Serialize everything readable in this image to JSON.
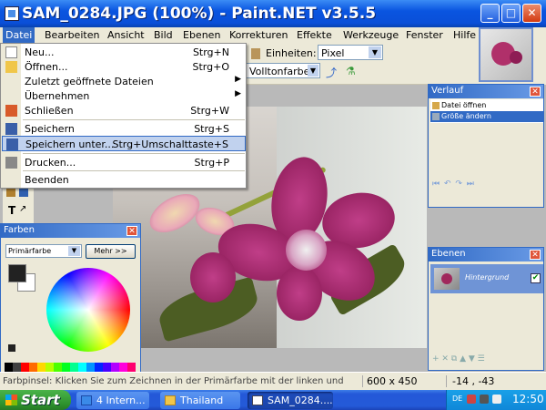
{
  "window": {
    "title": "SAM_0284.JPG (100%) - Paint.NET v3.5.5"
  },
  "window_controls": {
    "minimize": "_",
    "maximize": "□",
    "close": "✕"
  },
  "menubar": {
    "items": [
      "Datei",
      "Bearbeiten",
      "Ansicht",
      "Bild",
      "Ebenen",
      "Korrekturen",
      "Effekte",
      "Werkzeuge",
      "Fenster",
      "Hilfe"
    ],
    "active": "Datei"
  },
  "toolbar": {
    "units_label": "Einheiten:",
    "units_value": "Pixel",
    "fill_value": "Volltonfarbe"
  },
  "file_menu": {
    "items": [
      {
        "label": "Neu...",
        "shortcut": "Strg+N"
      },
      {
        "label": "Öffnen...",
        "shortcut": "Strg+O"
      },
      {
        "label": "Zuletzt geöffnete Dateien",
        "shortcut": ""
      },
      {
        "label": "Übernehmen",
        "shortcut": ""
      },
      {
        "label": "Schließen",
        "shortcut": "Strg+W"
      },
      {
        "label": "Speichern",
        "shortcut": "Strg+S"
      },
      {
        "label": "Speichern unter...",
        "shortcut": "Strg+Umschalttaste+S"
      },
      {
        "label": "Drucken...",
        "shortcut": "Strg+P"
      },
      {
        "label": "Beenden",
        "shortcut": ""
      }
    ],
    "highlighted": "Speichern unter..."
  },
  "history_panel": {
    "title": "Verlauf",
    "items": [
      "Datei öffnen",
      "Größe ändern"
    ],
    "selected": "Größe ändern",
    "close": "✕",
    "controls": "⏮ ↶ ↷ ⏭"
  },
  "layers_panel": {
    "title": "Ebenen",
    "layer_name": "Hintergrund",
    "visible_check": "✔",
    "close": "✕",
    "controls": "+ ✕ ⧉ ▲ ▼ ☰"
  },
  "colors_panel": {
    "title": "Farben",
    "mode": "Primärfarbe",
    "more_button": "Mehr >>",
    "close": "✕",
    "primary_color": "#222222",
    "secondary_color": "#ffffff",
    "palette": [
      "#000000",
      "#404040",
      "#ff0000",
      "#ff6a00",
      "#ffd800",
      "#b6ff00",
      "#4cff00",
      "#00ff21",
      "#00ff90",
      "#00ffff",
      "#0094ff",
      "#0026ff",
      "#4800ff",
      "#b200ff",
      "#ff00dc",
      "#ff006e"
    ]
  },
  "statusbar": {
    "hint": "Farbpinsel: Klicken Sie zum Zeichnen in der Primärfarbe mit der linken und",
    "image_size": "600 x 450",
    "coords": "-14 , -43"
  },
  "taskbar": {
    "start": "Start",
    "tasks": [
      {
        "label": "4 Intern...",
        "active": false
      },
      {
        "label": "Thailand",
        "active": false
      },
      {
        "label": "SAM_0284....",
        "active": true
      }
    ],
    "language": "DE",
    "clock": "12:50"
  }
}
